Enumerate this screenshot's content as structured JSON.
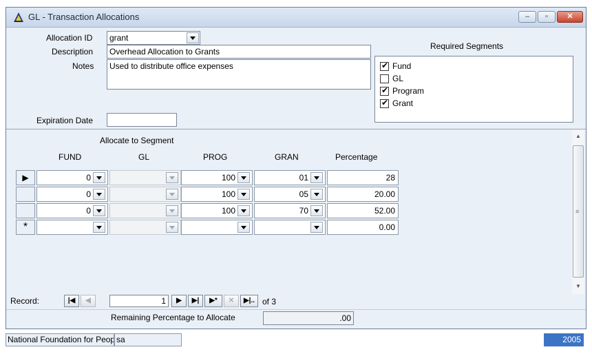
{
  "window": {
    "title": "GL - Transaction Allocations",
    "minimize_icon": "minimize-icon",
    "restore_icon": "restore-icon",
    "close_icon": "close-icon"
  },
  "form": {
    "allocation_id_label": "Allocation ID",
    "allocation_id_value": "grant",
    "description_label": "Description",
    "description_value": "Overhead Allocation to Grants",
    "notes_label": "Notes",
    "notes_value": "Used to distribute office expenses",
    "expiration_label": "Expiration Date",
    "expiration_value": ""
  },
  "required_segments": {
    "title": "Required Segments",
    "items": [
      {
        "label": "Fund",
        "checked": true
      },
      {
        "label": "GL",
        "checked": false
      },
      {
        "label": "Program",
        "checked": true
      },
      {
        "label": "Grant",
        "checked": true
      }
    ]
  },
  "grid": {
    "group_header": "Allocate to Segment",
    "columns": [
      "FUND",
      "GL",
      "PROG",
      "GRAN",
      "Percentage"
    ],
    "rows": [
      {
        "selector": "▶",
        "fund": "0",
        "gl": "",
        "prog": "100",
        "gran": "01",
        "pct": "28"
      },
      {
        "selector": "",
        "fund": "0",
        "gl": "",
        "prog": "100",
        "gran": "05",
        "pct": "20.00"
      },
      {
        "selector": "",
        "fund": "0",
        "gl": "",
        "prog": "100",
        "gran": "70",
        "pct": "52.00"
      },
      {
        "selector": "*",
        "fund": "",
        "gl": "",
        "prog": "",
        "gran": "",
        "pct": "0.00"
      }
    ]
  },
  "record_nav": {
    "label": "Record:",
    "current": "1",
    "of_text": "of 3"
  },
  "remaining": {
    "label": "Remaining Percentage to Allocate",
    "value": ".00"
  },
  "status": {
    "org": "National Foundation for Peop",
    "user": "sa",
    "year": "2005"
  }
}
